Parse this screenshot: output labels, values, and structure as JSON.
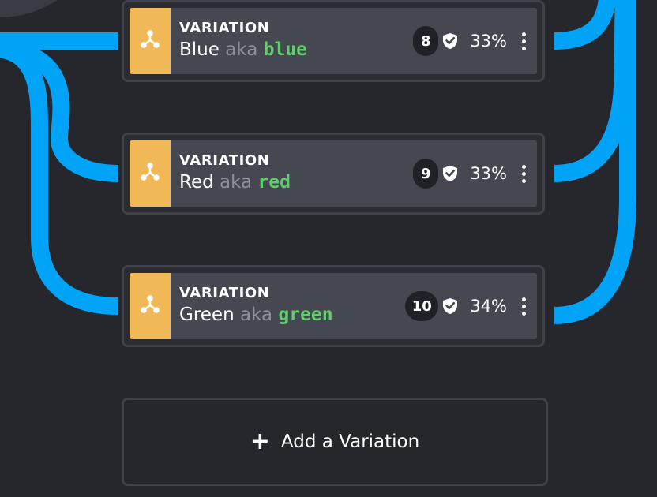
{
  "colors": {
    "background": "#25272c",
    "connector": "#00a3f5",
    "icon_strip": "#f0b856",
    "key_text": "#5fcf6c",
    "aka_text": "#8e9099"
  },
  "variations": [
    {
      "type_label": "VARIATION",
      "display_name": "Blue",
      "aka": "aka",
      "key": "blue",
      "count": "8",
      "percent": "33%",
      "icon": "fork-icon",
      "shield_icon": "shield-check-icon",
      "menu_icon": "more-vertical-icon"
    },
    {
      "type_label": "VARIATION",
      "display_name": "Red",
      "aka": "aka",
      "key": "red",
      "count": "9",
      "percent": "33%",
      "icon": "fork-icon",
      "shield_icon": "shield-check-icon",
      "menu_icon": "more-vertical-icon"
    },
    {
      "type_label": "VARIATION",
      "display_name": "Green",
      "aka": "aka",
      "key": "green",
      "count": "10",
      "percent": "34%",
      "icon": "fork-icon",
      "shield_icon": "shield-check-icon",
      "menu_icon": "more-vertical-icon"
    }
  ],
  "add_variation": {
    "label": "Add a Variation",
    "icon": "plus-icon"
  }
}
